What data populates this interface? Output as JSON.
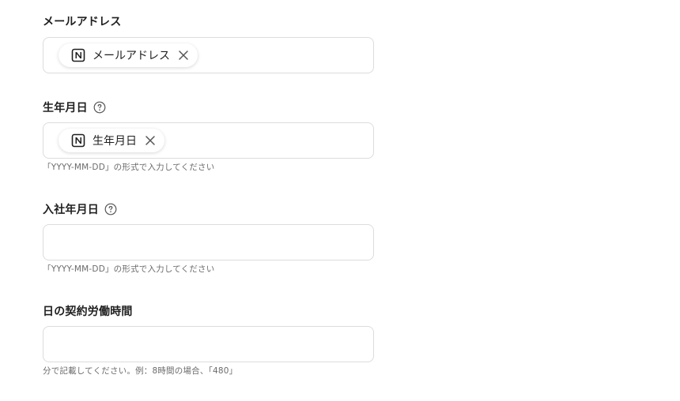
{
  "fields": [
    {
      "label": "メールアドレス",
      "chip_label": "メールアドレス",
      "chip_icon": "notion-icon",
      "help": false
    },
    {
      "label": "生年月日",
      "chip_label": "生年月日",
      "chip_icon": "notion-icon",
      "help": true,
      "hint": "「YYYY-MM-DD」の形式で入力してください"
    },
    {
      "label": "入社年月日",
      "value": "",
      "help": true,
      "hint": "「YYYY-MM-DD」の形式で入力してください"
    },
    {
      "label": "日の契約労働時間",
      "value": "",
      "help": false,
      "hint": "分で記載してください。例：8時間の場合、「480」"
    }
  ],
  "colors": {
    "border": "#dcdcdc",
    "label": "#1f1f1f",
    "hint": "#6b6b6b",
    "icon": "#555555"
  }
}
